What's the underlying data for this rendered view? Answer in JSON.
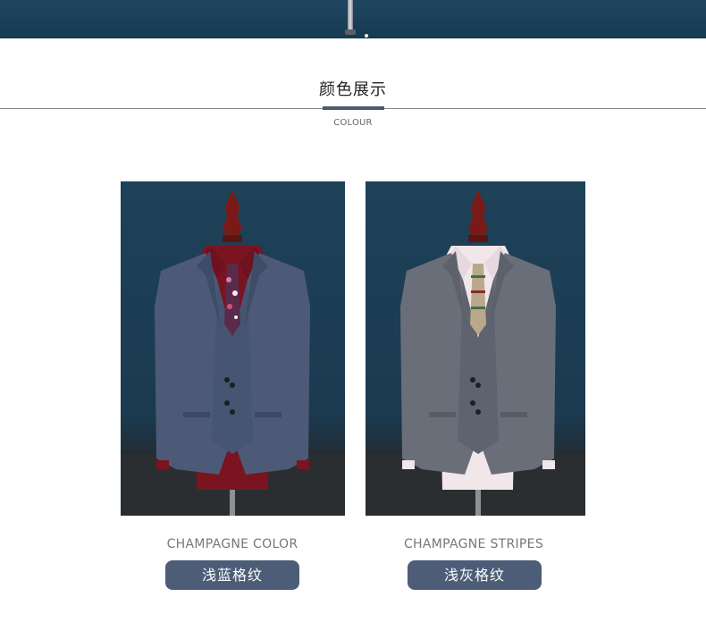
{
  "section": {
    "title": "颜色展示",
    "subtitle": "COLOUR"
  },
  "products": [
    {
      "label": "CHAMPAGNE COLOR",
      "button_label": "浅蓝格纹",
      "jacket_color": "#4c5a78",
      "shirt_color": "#7a1420",
      "tie_color": "#5a2a4a"
    },
    {
      "label": "CHAMPAGNE STRIPES",
      "button_label": "浅灰格纹",
      "jacket_color": "#6a6e79",
      "shirt_color": "#f1e6ea",
      "tie_color": "#b9a98a"
    }
  ],
  "colors": {
    "banner": "#1f4660",
    "button_bg": "#4d5d77",
    "button_text": "#ffffff",
    "title_text": "#222222",
    "label_text": "#777777"
  }
}
